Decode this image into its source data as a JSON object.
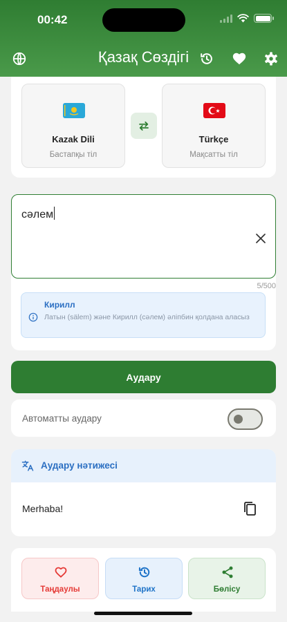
{
  "status_bar": {
    "time": "00:42"
  },
  "header": {
    "title": "Қазақ Сөздігі",
    "icons": [
      "globe-icon",
      "history-icon",
      "heart-icon",
      "gear-icon"
    ]
  },
  "languages": {
    "source": {
      "name": "Kazak Dili",
      "role": "Бастапқы тіл",
      "flag": "kazakhstan-flag"
    },
    "target": {
      "name": "Türkçe",
      "role": "Мақсатты тіл",
      "flag": "turkey-flag"
    },
    "swap_icon": "swap-icon"
  },
  "input": {
    "value": "сәлем",
    "counter": "5/500",
    "info_title": "Кирилл",
    "info_text": "Латын (sälem) және Кирилл (сәлем) әліпбин қолдана аласыз"
  },
  "translate_button": "Аудару",
  "auto_translate": {
    "label": "Автоматты аудару",
    "enabled": false
  },
  "result": {
    "title": "Аудару нәтижесі",
    "text": "Merhaba!"
  },
  "actions": [
    {
      "label": "Таңдаулы",
      "icon": "heart-outline-icon",
      "color": "#e53935"
    },
    {
      "label": "Тарих",
      "icon": "history-icon",
      "color": "#1e73c8"
    },
    {
      "label": "Бөлісу",
      "icon": "share-icon",
      "color": "#2e7d32"
    }
  ],
  "colors": {
    "primary": "#2e7d32",
    "accent_blue": "#2b6fc2"
  }
}
